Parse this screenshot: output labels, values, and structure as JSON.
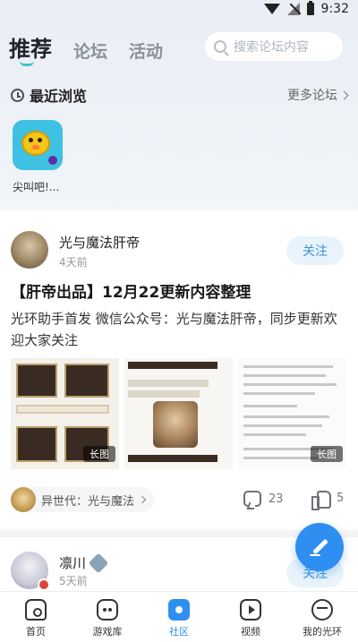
{
  "status_bar": {
    "time": "9:32"
  },
  "header": {
    "tabs": [
      {
        "label": "推荐",
        "active": true
      },
      {
        "label": "论坛",
        "active": false
      },
      {
        "label": "活动",
        "active": false
      }
    ],
    "search_placeholder": "搜索论坛内容"
  },
  "recent": {
    "title": "最近浏览",
    "more_label": "更多论坛",
    "items": [
      {
        "label": "尖叫吧!..."
      }
    ]
  },
  "post1": {
    "author": "光与魔法肝帝",
    "time": "4天前",
    "follow_label": "关注",
    "title": "【肝帝出品】12月22更新内容整理",
    "body": "光环助手首发 微信公众号：光与魔法肝帝，同步更新欢迎大家关注",
    "image_badges": [
      "长图",
      "长图"
    ],
    "tag": "异世代：光与魔法",
    "comment_count": "23",
    "like_count": "5"
  },
  "post2": {
    "author": "凛川",
    "time": "5天前",
    "follow_label": "关注"
  },
  "bottom_nav": [
    {
      "label": "首页",
      "icon": "home-icon",
      "active": false
    },
    {
      "label": "游戏库",
      "icon": "game-library-icon",
      "active": false
    },
    {
      "label": "社区",
      "icon": "community-icon",
      "active": true
    },
    {
      "label": "视频",
      "icon": "video-icon",
      "active": false
    },
    {
      "label": "我的光环",
      "icon": "profile-icon",
      "active": false
    }
  ],
  "colors": {
    "accent": "#2f8ff0",
    "tab_indicator": "#3ec6c0",
    "follow_text": "#3a8fd6"
  }
}
